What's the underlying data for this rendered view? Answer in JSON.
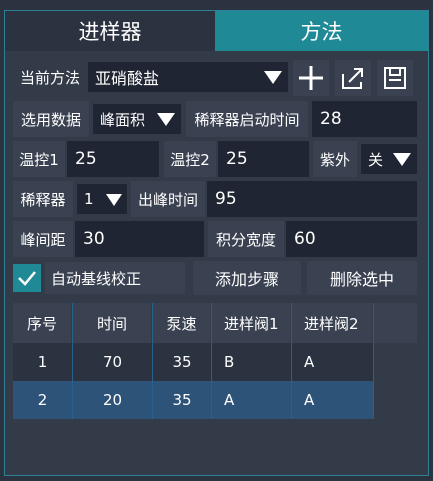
{
  "tabs": [
    {
      "label": "进样器",
      "active": false
    },
    {
      "label": "方法",
      "active": true
    }
  ],
  "method": {
    "label": "当前方法",
    "selected": "亚硝酸盐",
    "icons": [
      "plus-icon",
      "export-icon",
      "save-icon"
    ]
  },
  "data_select": {
    "label": "选用数据",
    "selected": "峰面积"
  },
  "diluter_start": {
    "label": "稀释器启动时间",
    "value": "28"
  },
  "temp1": {
    "label": "温控1",
    "value": "25"
  },
  "temp2": {
    "label": "温控2",
    "value": "25"
  },
  "uv": {
    "label": "紫外",
    "selected": "关"
  },
  "diluter": {
    "label": "稀释器",
    "selected": "1"
  },
  "peak_time": {
    "label": "出峰时间",
    "value": "95"
  },
  "peak_gap": {
    "label": "峰间距",
    "value": "30"
  },
  "integral_width": {
    "label": "积分宽度",
    "value": "60"
  },
  "auto_baseline": {
    "label": "自动基线校正",
    "checked": true
  },
  "buttons": {
    "add_step": "添加步骤",
    "delete_selected": "删除选中"
  },
  "table": {
    "headers": [
      "序号",
      "时间",
      "泵速",
      "进样阀1",
      "进样阀2"
    ],
    "rows": [
      [
        "1",
        "70",
        "35",
        "B",
        "A"
      ],
      [
        "2",
        "20",
        "35",
        "A",
        "A"
      ]
    ]
  },
  "colors": {
    "background": "#2b3240",
    "active_tab": "#1f8a96",
    "field": "#1f2532",
    "label": "#3a4252",
    "selected_row": "#2e5378",
    "checkbox": "#1f8a96"
  }
}
